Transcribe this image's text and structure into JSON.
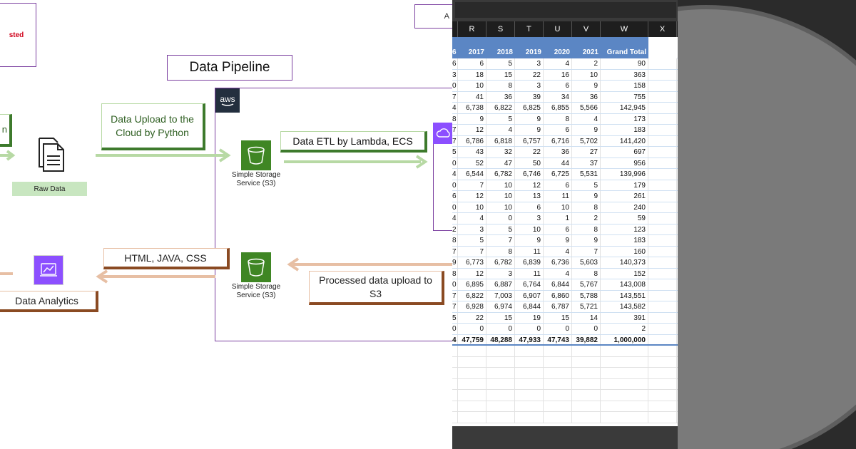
{
  "diagram": {
    "pipeline_title": "Data Pipeline",
    "top_left_fragment": "sted",
    "aws_logo": "aws",
    "green_left_fragment": "n",
    "upload_box": "Data Upload to the Cloud by Python",
    "raw_data": "Raw Data",
    "s3_top_label": "Simple Storage Service (S3)",
    "etl_box": "Data ETL by Lambda, ECS",
    "html_box": "HTML, JAVA, CSS",
    "s3_bottom_label": "Simple Storage Service (S3)",
    "processed_box": "Processed data upload to S3",
    "analytics_box": "Data Analytics",
    "top_right_fragment": "A",
    "icons": [
      "document-icon",
      "s3-bucket-icon",
      "analytics-icon",
      "cloud-icon"
    ],
    "colors": {
      "purple": "#7b3fa0",
      "green": "#3d7a2c",
      "brown": "#8a4a22",
      "s3": "#3f8624",
      "analytics": "#8c4fff"
    }
  },
  "spreadsheet": {
    "columns": [
      "",
      "R",
      "S",
      "T",
      "U",
      "V",
      "W",
      "X"
    ],
    "header_row": [
      "6",
      "2017",
      "2018",
      "2019",
      "2020",
      "2021",
      "Grand Total"
    ],
    "rows": [
      [
        "6",
        "6",
        "5",
        "3",
        "4",
        "2",
        "90"
      ],
      [
        "3",
        "18",
        "15",
        "22",
        "16",
        "10",
        "363"
      ],
      [
        "0",
        "10",
        "8",
        "3",
        "6",
        "9",
        "158"
      ],
      [
        "7",
        "41",
        "36",
        "39",
        "34",
        "36",
        "755"
      ],
      [
        "4",
        "6,738",
        "6,822",
        "6,825",
        "6,855",
        "5,566",
        "142,945"
      ],
      [
        "8",
        "9",
        "5",
        "9",
        "8",
        "4",
        "173"
      ],
      [
        "7",
        "12",
        "4",
        "9",
        "6",
        "9",
        "183"
      ],
      [
        "7",
        "6,786",
        "6,818",
        "6,757",
        "6,716",
        "5,702",
        "141,420"
      ],
      [
        "5",
        "43",
        "32",
        "22",
        "36",
        "27",
        "697"
      ],
      [
        "0",
        "52",
        "47",
        "50",
        "44",
        "37",
        "956"
      ],
      [
        "4",
        "6,544",
        "6,782",
        "6,746",
        "6,725",
        "5,531",
        "139,996"
      ],
      [
        "0",
        "7",
        "10",
        "12",
        "6",
        "5",
        "179"
      ],
      [
        "6",
        "12",
        "10",
        "13",
        "11",
        "9",
        "261"
      ],
      [
        "0",
        "10",
        "10",
        "6",
        "10",
        "8",
        "240"
      ],
      [
        "4",
        "4",
        "0",
        "3",
        "1",
        "2",
        "59"
      ],
      [
        "2",
        "3",
        "5",
        "10",
        "6",
        "8",
        "123"
      ],
      [
        "8",
        "5",
        "7",
        "9",
        "9",
        "9",
        "183"
      ],
      [
        "7",
        "7",
        "8",
        "11",
        "4",
        "7",
        "160"
      ],
      [
        "9",
        "6,773",
        "6,782",
        "6,839",
        "6,736",
        "5,603",
        "140,373"
      ],
      [
        "8",
        "12",
        "3",
        "11",
        "4",
        "8",
        "152"
      ],
      [
        "0",
        "6,895",
        "6,887",
        "6,764",
        "6,844",
        "5,767",
        "143,008"
      ],
      [
        "7",
        "6,822",
        "7,003",
        "6,907",
        "6,860",
        "5,788",
        "143,551"
      ],
      [
        "7",
        "6,928",
        "6,974",
        "6,844",
        "6,787",
        "5,721",
        "143,582"
      ],
      [
        "5",
        "22",
        "15",
        "19",
        "15",
        "14",
        "391"
      ],
      [
        "0",
        "0",
        "0",
        "0",
        "0",
        "0",
        "2"
      ]
    ],
    "total_row": [
      "4",
      "47,759",
      "48,288",
      "47,933",
      "47,743",
      "39,882",
      "1,000,000"
    ],
    "header_color": "#5b86c4"
  }
}
